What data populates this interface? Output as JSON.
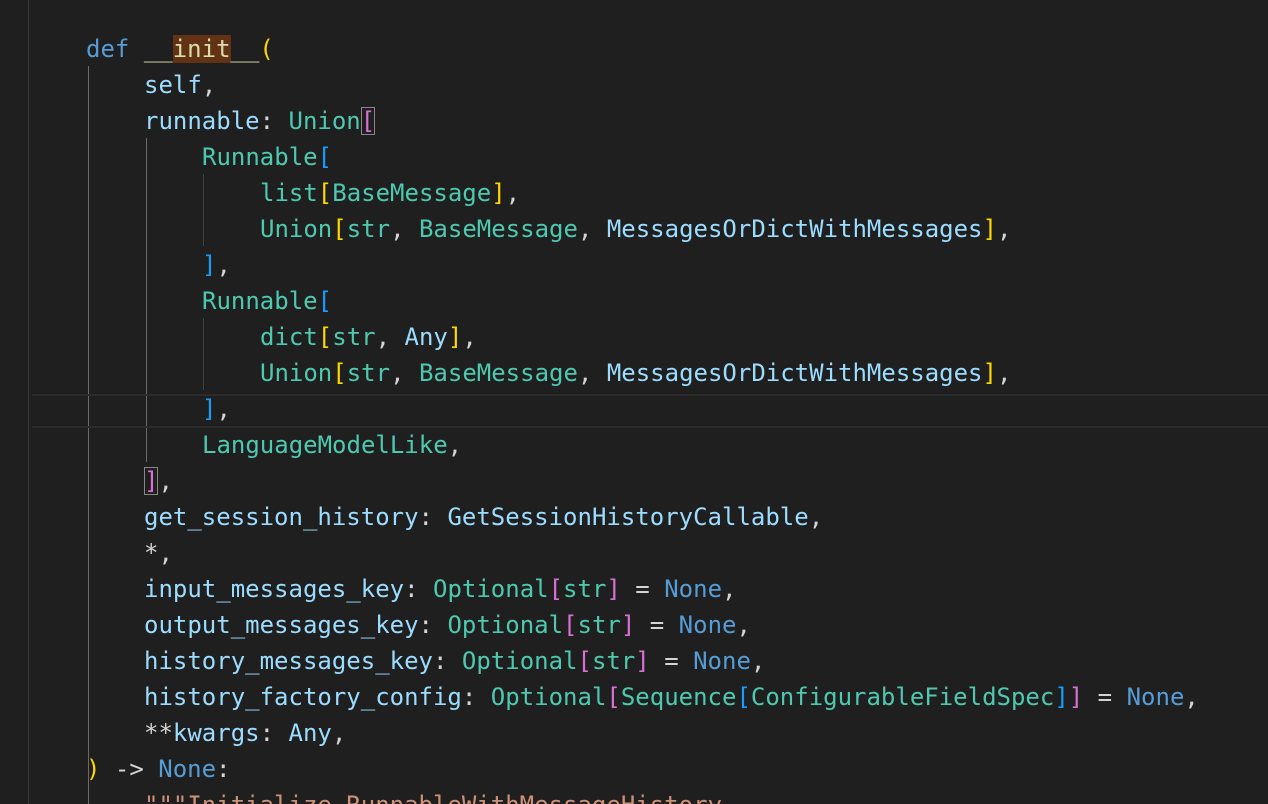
{
  "code_lines": [
    [
      {
        "t": "def",
        "c": "kw"
      },
      {
        "t": " ",
        "c": "plain"
      },
      {
        "t": "__",
        "c": "fn"
      },
      {
        "t": "init",
        "c": "fn-hl"
      },
      {
        "t": "__",
        "c": "fn"
      },
      {
        "t": "(",
        "c": "b1"
      }
    ],
    [
      {
        "t": "self",
        "c": "param"
      },
      {
        "t": ",",
        "c": "plain"
      }
    ],
    [
      {
        "t": "runnable",
        "c": "param"
      },
      {
        "t": ": ",
        "c": "plain"
      },
      {
        "t": "Union",
        "c": "type"
      },
      {
        "t": "[",
        "c": "b2 b-box"
      }
    ],
    [
      {
        "t": "Runnable",
        "c": "type"
      },
      {
        "t": "[",
        "c": "b3"
      }
    ],
    [
      {
        "t": "list",
        "c": "type"
      },
      {
        "t": "[",
        "c": "b1"
      },
      {
        "t": "BaseMessage",
        "c": "type"
      },
      {
        "t": "]",
        "c": "b1"
      },
      {
        "t": ",",
        "c": "plain"
      }
    ],
    [
      {
        "t": "Union",
        "c": "type"
      },
      {
        "t": "[",
        "c": "b1"
      },
      {
        "t": "str",
        "c": "type"
      },
      {
        "t": ", ",
        "c": "plain"
      },
      {
        "t": "BaseMessage",
        "c": "type"
      },
      {
        "t": ", ",
        "c": "plain"
      },
      {
        "t": "MessagesOrDictWithMessages",
        "c": "param"
      },
      {
        "t": "]",
        "c": "b1"
      },
      {
        "t": ",",
        "c": "plain"
      }
    ],
    [
      {
        "t": "]",
        "c": "b3"
      },
      {
        "t": ",",
        "c": "plain"
      }
    ],
    [
      {
        "t": "Runnable",
        "c": "type"
      },
      {
        "t": "[",
        "c": "b3"
      }
    ],
    [
      {
        "t": "dict",
        "c": "type"
      },
      {
        "t": "[",
        "c": "b1"
      },
      {
        "t": "str",
        "c": "type"
      },
      {
        "t": ", ",
        "c": "plain"
      },
      {
        "t": "Any",
        "c": "param"
      },
      {
        "t": "]",
        "c": "b1"
      },
      {
        "t": ",",
        "c": "plain"
      }
    ],
    [
      {
        "t": "Union",
        "c": "type"
      },
      {
        "t": "[",
        "c": "b1"
      },
      {
        "t": "str",
        "c": "type"
      },
      {
        "t": ", ",
        "c": "plain"
      },
      {
        "t": "BaseMessage",
        "c": "type"
      },
      {
        "t": ", ",
        "c": "plain"
      },
      {
        "t": "MessagesOrDictWithMessages",
        "c": "param"
      },
      {
        "t": "]",
        "c": "b1"
      },
      {
        "t": ",",
        "c": "plain"
      }
    ],
    [
      {
        "t": "]",
        "c": "b3"
      },
      {
        "t": ",",
        "c": "plain"
      }
    ],
    [
      {
        "t": "LanguageModelLike",
        "c": "type"
      },
      {
        "t": ",",
        "c": "plain"
      }
    ],
    [
      {
        "t": "]",
        "c": "b2 b-box"
      },
      {
        "t": ",",
        "c": "plain"
      }
    ],
    [
      {
        "t": "get_session_history",
        "c": "param"
      },
      {
        "t": ": ",
        "c": "plain"
      },
      {
        "t": "GetSessionHistoryCallable",
        "c": "param"
      },
      {
        "t": ",",
        "c": "plain"
      }
    ],
    [
      {
        "t": "*",
        "c": "plain"
      },
      {
        "t": ",",
        "c": "plain"
      }
    ],
    [
      {
        "t": "input_messages_key",
        "c": "param"
      },
      {
        "t": ": ",
        "c": "plain"
      },
      {
        "t": "Optional",
        "c": "type"
      },
      {
        "t": "[",
        "c": "b2"
      },
      {
        "t": "str",
        "c": "type"
      },
      {
        "t": "]",
        "c": "b2"
      },
      {
        "t": " = ",
        "c": "plain"
      },
      {
        "t": "None",
        "c": "const"
      },
      {
        "t": ",",
        "c": "plain"
      }
    ],
    [
      {
        "t": "output_messages_key",
        "c": "param"
      },
      {
        "t": ": ",
        "c": "plain"
      },
      {
        "t": "Optional",
        "c": "type"
      },
      {
        "t": "[",
        "c": "b2"
      },
      {
        "t": "str",
        "c": "type"
      },
      {
        "t": "]",
        "c": "b2"
      },
      {
        "t": " = ",
        "c": "plain"
      },
      {
        "t": "None",
        "c": "const"
      },
      {
        "t": ",",
        "c": "plain"
      }
    ],
    [
      {
        "t": "history_messages_key",
        "c": "param"
      },
      {
        "t": ": ",
        "c": "plain"
      },
      {
        "t": "Optional",
        "c": "type"
      },
      {
        "t": "[",
        "c": "b2"
      },
      {
        "t": "str",
        "c": "type"
      },
      {
        "t": "]",
        "c": "b2"
      },
      {
        "t": " = ",
        "c": "plain"
      },
      {
        "t": "None",
        "c": "const"
      },
      {
        "t": ",",
        "c": "plain"
      }
    ],
    [
      {
        "t": "history_factory_config",
        "c": "param"
      },
      {
        "t": ": ",
        "c": "plain"
      },
      {
        "t": "Optional",
        "c": "type"
      },
      {
        "t": "[",
        "c": "b2"
      },
      {
        "t": "Sequence",
        "c": "type"
      },
      {
        "t": "[",
        "c": "b3"
      },
      {
        "t": "ConfigurableFieldSpec",
        "c": "type"
      },
      {
        "t": "]",
        "c": "b3"
      },
      {
        "t": "]",
        "c": "b2"
      },
      {
        "t": " = ",
        "c": "plain"
      },
      {
        "t": "None",
        "c": "const"
      },
      {
        "t": ",",
        "c": "plain"
      }
    ],
    [
      {
        "t": "**",
        "c": "plain"
      },
      {
        "t": "kwargs",
        "c": "param"
      },
      {
        "t": ": ",
        "c": "plain"
      },
      {
        "t": "Any",
        "c": "param"
      },
      {
        "t": ",",
        "c": "plain"
      }
    ],
    [
      {
        "t": ")",
        "c": "b1"
      },
      {
        "t": " -> ",
        "c": "plain"
      },
      {
        "t": "None",
        "c": "const"
      },
      {
        "t": ":",
        "c": "plain"
      }
    ],
    [
      {
        "t": "\"\"\"Initialize RunnableWithMessageHistory.",
        "c": "doc"
      }
    ]
  ]
}
